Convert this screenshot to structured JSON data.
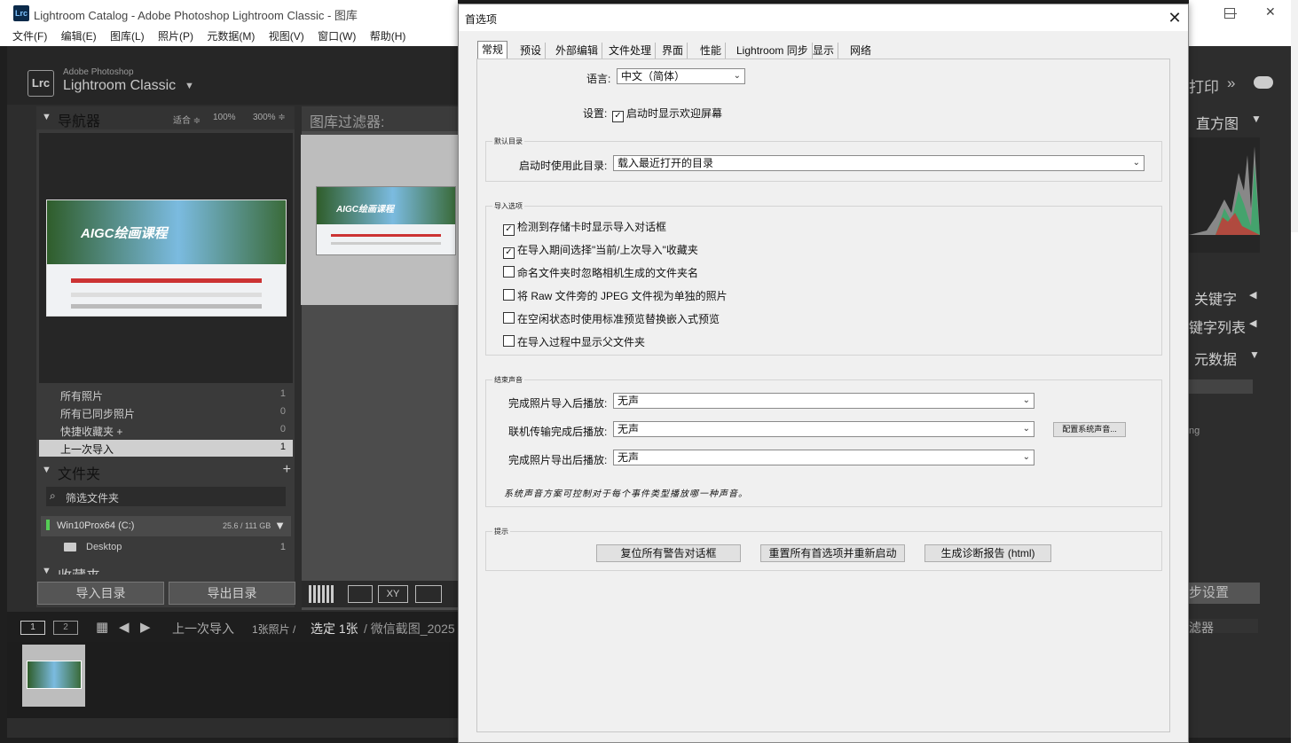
{
  "lr": {
    "window_title": "Lightroom Catalog - Adobe Photoshop Lightroom Classic - 图库",
    "logo_text": "Lrc",
    "menu": [
      "文件(F)",
      "编辑(E)",
      "图库(L)",
      "照片(P)",
      "元数据(M)",
      "视图(V)",
      "窗口(W)",
      "帮助(H)"
    ],
    "brand_small": "Adobe Photoshop",
    "brand_large": "Lightroom Classic",
    "navigator": {
      "label": "导航器",
      "fit": "适合 ≑",
      "z100": "100%",
      "z300": "300% ≑"
    },
    "thumb_text": "AIGC绘画课程",
    "catalog": [
      {
        "name": "所有照片",
        "count": "1"
      },
      {
        "name": "所有已同步照片",
        "count": "0"
      },
      {
        "name": "快捷收藏夹 +",
        "count": "0"
      },
      {
        "name": "上一次导入",
        "count": "1"
      }
    ],
    "folders_label": "文件夹",
    "folder_filter": "筛选文件夹",
    "drive": {
      "name": "Win10Prox64 (C:)",
      "size": "25.6 / 111 GB"
    },
    "desktop": {
      "name": "Desktop",
      "count": "1"
    },
    "collections_label": "收藏夹",
    "import_btn": "导入目录",
    "export_btn": "导出目录",
    "library_filter": "图库过滤器:",
    "filmstrip_text": "上一次导入",
    "filmstrip_count": "1张照片 /",
    "filmstrip_sel": "选定 1张",
    "filmstrip_file": "/ 微信截图_2025",
    "page1": "1",
    "page2": "2",
    "right": {
      "print": "打印",
      "histogram": "直方图",
      "keywords": "关键字",
      "keyword_list": "键字列表",
      "metadata": "元数据",
      "settings": "步设置",
      "filter": "滤器",
      "ng": "ng"
    }
  },
  "dialog": {
    "title": "首选项",
    "close": "✕",
    "tabs": [
      "常规",
      "预设",
      "外部编辑",
      "文件处理",
      "界面",
      "性能",
      "Lightroom 同步",
      "显示",
      "网络"
    ],
    "language_label": "语言:",
    "language_value": "中文（简体）",
    "settings_label": "设置:",
    "settings_check": "启动时显示欢迎屏幕",
    "default_catalog_title": "默认目录",
    "default_catalog_label": "启动时使用此目录:",
    "default_catalog_value": "载入最近打开的目录",
    "import_title": "导入选项",
    "import_options": [
      {
        "label": "检测到存储卡时显示导入对话框",
        "checked": true
      },
      {
        "label": "在导入期间选择\"当前/上次导入\"收藏夹",
        "checked": true
      },
      {
        "label": "命名文件夹时忽略相机生成的文件夹名",
        "checked": false
      },
      {
        "label": "将 Raw 文件旁的 JPEG 文件视为单独的照片",
        "checked": false
      },
      {
        "label": "在空闲状态时使用标准预览替换嵌入式预览",
        "checked": false
      },
      {
        "label": "在导入过程中显示父文件夹",
        "checked": false
      }
    ],
    "sound_title": "结束声音",
    "sound_rows": [
      {
        "label": "完成照片导入后播放:",
        "value": "无声"
      },
      {
        "label": "联机传输完成后播放:",
        "value": "无声"
      },
      {
        "label": "完成照片导出后播放:",
        "value": "无声"
      }
    ],
    "config_sound_btn": "配置系统声音...",
    "sound_note": "系统声音方案可控制对于每个事件类型播放哪一种声音。",
    "tips_title": "提示",
    "tip_buttons": [
      "复位所有警告对话框",
      "重置所有首选项并重新启动",
      "生成诊断报告 (html)"
    ]
  },
  "colors": {
    "lr_bg": "#2d2d2d",
    "dialog_bg": "#f0f0f0",
    "selected_row": "#cfcfcf"
  }
}
